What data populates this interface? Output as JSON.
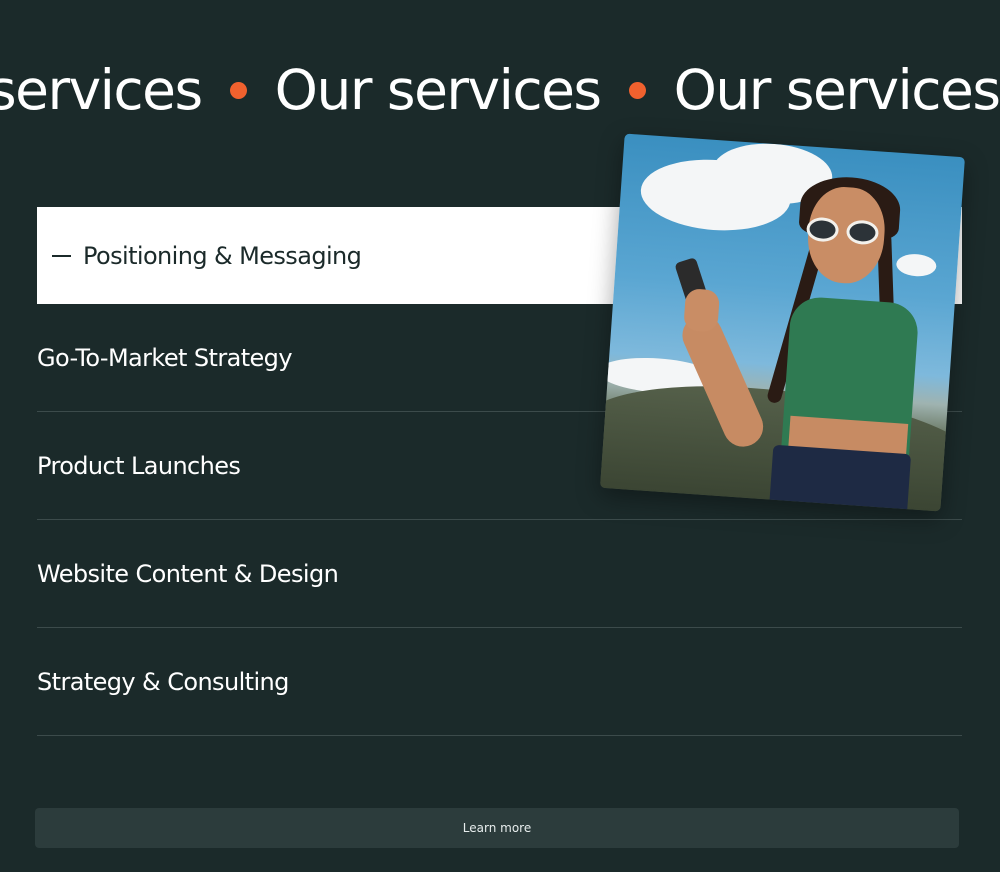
{
  "marquee": {
    "words": [
      "services",
      "Our services",
      "Our services"
    ],
    "dot_color": "#f0612e"
  },
  "services": {
    "items": [
      {
        "label": "Positioning & Messaging",
        "active": true
      },
      {
        "label": "Go-To-Market Strategy",
        "active": false
      },
      {
        "label": "Product Launches",
        "active": false
      },
      {
        "label": "Website Content & Design",
        "active": false
      },
      {
        "label": "Strategy & Consulting",
        "active": false
      }
    ]
  },
  "cta": {
    "label": "Learn more"
  },
  "colors": {
    "background": "#1b2a2a",
    "accent": "#f0612e",
    "active_row": "#ffffff",
    "button": "#2c3c3c"
  }
}
